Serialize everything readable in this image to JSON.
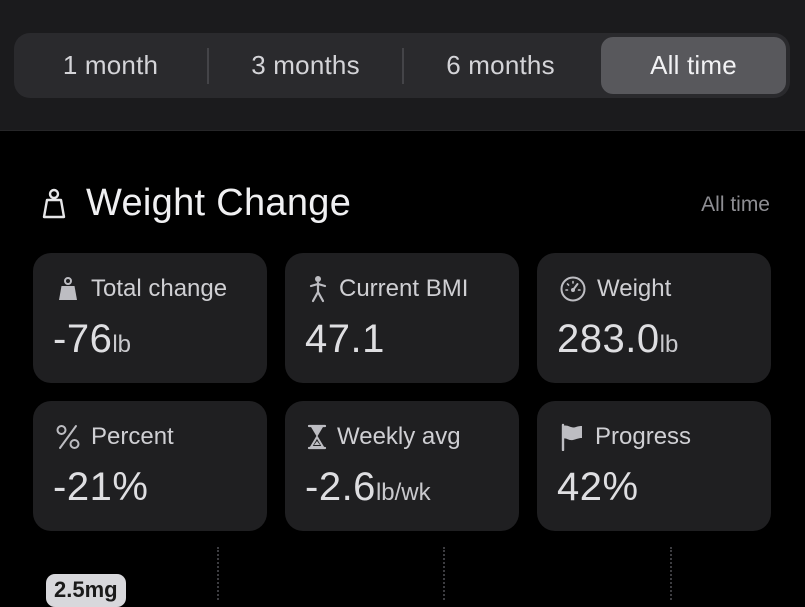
{
  "time_range": {
    "options": [
      "1 month",
      "3 months",
      "6 months",
      "All time"
    ],
    "selected": "All time"
  },
  "section": {
    "title": "Weight Change",
    "range_label": "All time"
  },
  "stats": [
    {
      "label": "Total change",
      "value": "-76",
      "unit": "lb",
      "icon": "weight-bag-icon"
    },
    {
      "label": "Current BMI",
      "value": "47.1",
      "unit": "",
      "icon": "person-icon"
    },
    {
      "label": "Weight",
      "value": "283.0",
      "unit": "lb",
      "icon": "scale-gauge-icon"
    },
    {
      "label": "Percent",
      "value": "-21%",
      "unit": "",
      "icon": "percent-icon"
    },
    {
      "label": "Weekly avg",
      "value": "-2.6",
      "unit": "lb/wk",
      "icon": "hourglass-icon"
    },
    {
      "label": "Progress",
      "value": "42%",
      "unit": "",
      "icon": "flag-icon"
    }
  ],
  "chart": {
    "dose_label": "2.5mg"
  },
  "colors": {
    "background": "#000000",
    "header_bg": "#1b1b1d",
    "card_bg": "#1f1f21",
    "segment_active": "#58585c",
    "muted_text": "#8e8e93"
  }
}
